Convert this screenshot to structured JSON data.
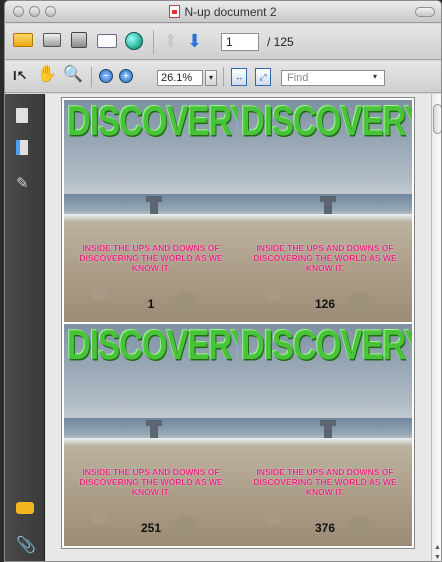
{
  "window": {
    "title": "N-up document 2"
  },
  "toolbar": {
    "page_current": "1",
    "page_total": "/ 125",
    "zoom": "26.1%",
    "find_placeholder": "Find"
  },
  "document": {
    "tiles": [
      {
        "masthead": "DISCOVERY",
        "tagline": "INSIDE THE UPS AND DOWNS OF DISCOVERING THE WORLD AS WE KNOW IT.",
        "page": "1"
      },
      {
        "masthead": "DISCOVERY",
        "tagline": "INSIDE THE UPS AND DOWNS OF DISCOVERING THE WORLD AS WE KNOW IT.",
        "page": "126"
      },
      {
        "masthead": "DISCOVERY",
        "tagline": "INSIDE THE UPS AND DOWNS OF DISCOVERING THE WORLD AS WE KNOW IT.",
        "page": "251"
      },
      {
        "masthead": "DISCOVERY",
        "tagline": "INSIDE THE UPS AND DOWNS OF DISCOVERING THE WORLD AS WE KNOW IT.",
        "page": "376"
      }
    ]
  },
  "icons": {
    "toolbar1": [
      "folder-open-icon",
      "print-icon",
      "save-icon",
      "email-icon",
      "collaborate-icon",
      "previous-page-icon",
      "next-page-icon"
    ],
    "toolbar2": [
      "select-text-icon",
      "hand-tool-icon",
      "zoom-tool-icon",
      "zoom-out-icon",
      "zoom-in-icon",
      "fit-width-icon",
      "fit-page-icon"
    ],
    "sidebar": [
      "pages-icon",
      "bookmarks-icon",
      "signatures-icon",
      "comments-icon",
      "attachments-icon"
    ]
  },
  "colors": {
    "masthead_green": "#49c43a",
    "tagline_pink": "#e0277d",
    "sidebar_bg": "#3f3f3f"
  }
}
